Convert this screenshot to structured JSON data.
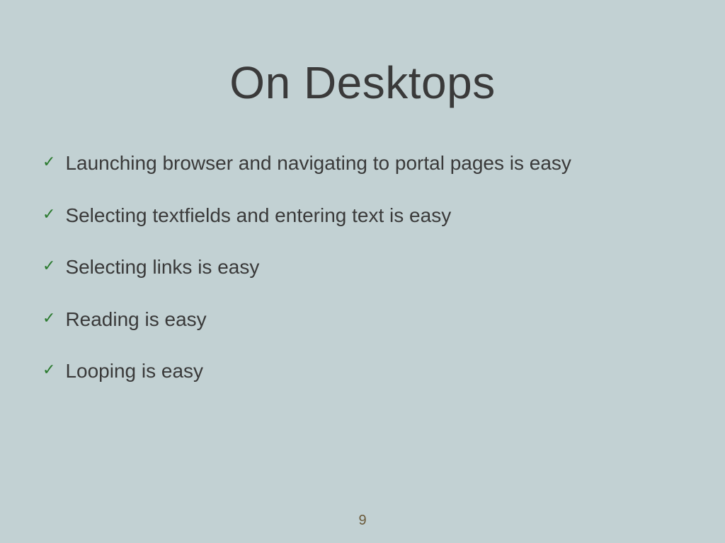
{
  "slide": {
    "title": "On Desktops",
    "bullets": [
      {
        "text": "Launching browser and navigating to portal pages is easy"
      },
      {
        "text": "Selecting textfields and entering text is easy"
      },
      {
        "text": "Selecting links is easy"
      },
      {
        "text": "Reading is easy"
      },
      {
        "text": "Looping is easy"
      }
    ],
    "checkmark": "✓",
    "pageNumber": "9"
  }
}
